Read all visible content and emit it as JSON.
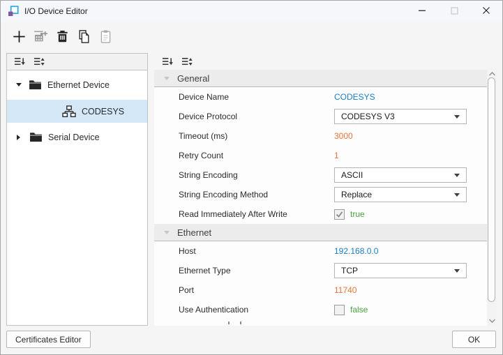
{
  "window": {
    "title": "I/O Device Editor"
  },
  "colors": {
    "value_blue": "#1a7dc4",
    "value_orange": "#e8743b",
    "value_green": "#48a23c",
    "selection_blue": "#d5e8f7"
  },
  "toolbar": {
    "buttons": [
      {
        "name": "add-device",
        "icon": "plus",
        "enabled": true
      },
      {
        "name": "add-device-group",
        "icon": "add-group",
        "enabled": false
      },
      {
        "name": "delete-device",
        "icon": "trash",
        "enabled": true
      },
      {
        "name": "copy-device",
        "icon": "copy",
        "enabled": true
      },
      {
        "name": "paste-device",
        "icon": "paste",
        "enabled": false
      }
    ]
  },
  "tree": {
    "items": [
      {
        "label": "Ethernet Device",
        "kind": "folder",
        "state": "expanded",
        "selected": false
      },
      {
        "label": "CODESYS",
        "kind": "device",
        "state": null,
        "selected": true
      },
      {
        "label": "Serial Device",
        "kind": "folder",
        "state": "collapsed",
        "selected": false
      }
    ]
  },
  "properties": {
    "sections": [
      {
        "title": "General",
        "rows": [
          {
            "label": "Device Name",
            "editor": "text",
            "value": "CODESYS",
            "color": "blue"
          },
          {
            "label": "Device Protocol",
            "editor": "dropdown",
            "value": "CODESYS V3"
          },
          {
            "label": "Timeout (ms)",
            "editor": "text",
            "value": "3000",
            "color": "orange"
          },
          {
            "label": "Retry Count",
            "editor": "text",
            "value": "1",
            "color": "orange"
          },
          {
            "label": "String Encoding",
            "editor": "dropdown",
            "value": "ASCII"
          },
          {
            "label": "String Encoding Method",
            "editor": "dropdown",
            "value": "Replace"
          },
          {
            "label": "Read Immediately After Write",
            "editor": "checkbox",
            "value": "true",
            "checked": true
          }
        ]
      },
      {
        "title": "Ethernet",
        "rows": [
          {
            "label": "Host",
            "editor": "text",
            "value": "192.168.0.0",
            "color": "blue"
          },
          {
            "label": "Ethernet Type",
            "editor": "dropdown",
            "value": "TCP"
          },
          {
            "label": "Port",
            "editor": "text",
            "value": "11740",
            "color": "orange"
          },
          {
            "label": "Use Authentication",
            "editor": "checkbox",
            "value": "false",
            "checked": false
          }
        ]
      }
    ],
    "partial_row_visible": true
  },
  "footer": {
    "certificates_button": "Certificates Editor",
    "ok_button": "OK"
  }
}
